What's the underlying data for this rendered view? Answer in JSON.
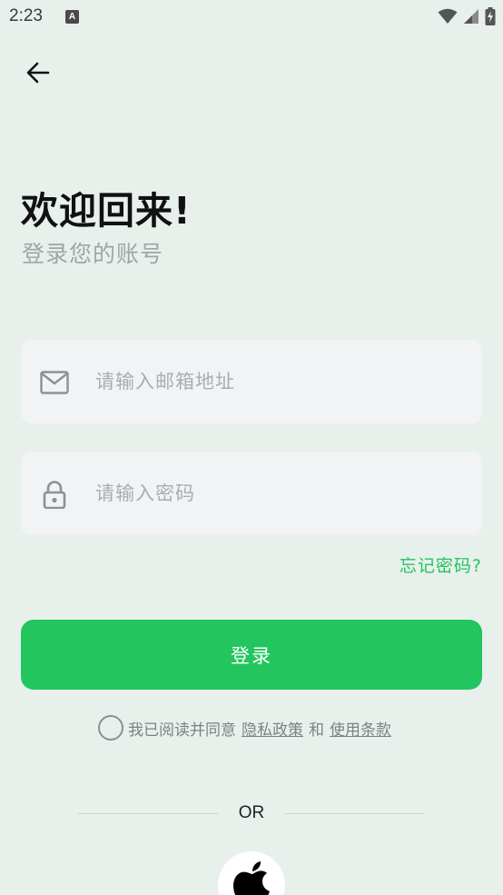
{
  "status_bar": {
    "time": "2:23",
    "notification_badge": "A"
  },
  "header": {
    "back_icon": "arrow-left-icon"
  },
  "welcome": {
    "title": "欢迎回来!",
    "subtitle": "登录您的账号"
  },
  "form": {
    "email": {
      "icon": "mail-icon",
      "placeholder": "请输入邮箱地址",
      "value": ""
    },
    "password": {
      "icon": "lock-icon",
      "placeholder": "请输入密码",
      "value": ""
    },
    "forgot_password": "忘记密码?",
    "login_button": "登录"
  },
  "agreement": {
    "checked": false,
    "prefix": "我已阅读并同意",
    "privacy_link": "隐私政策",
    "conjunction": "和",
    "terms_link": "使用条款"
  },
  "divider": {
    "label": "OR"
  },
  "social": {
    "apple_icon": "apple-icon"
  },
  "colors": {
    "background": "#e8f0ec",
    "accent": "#22c55e",
    "field_bg": "#f1f3f5",
    "placeholder": "#a8adb3"
  }
}
